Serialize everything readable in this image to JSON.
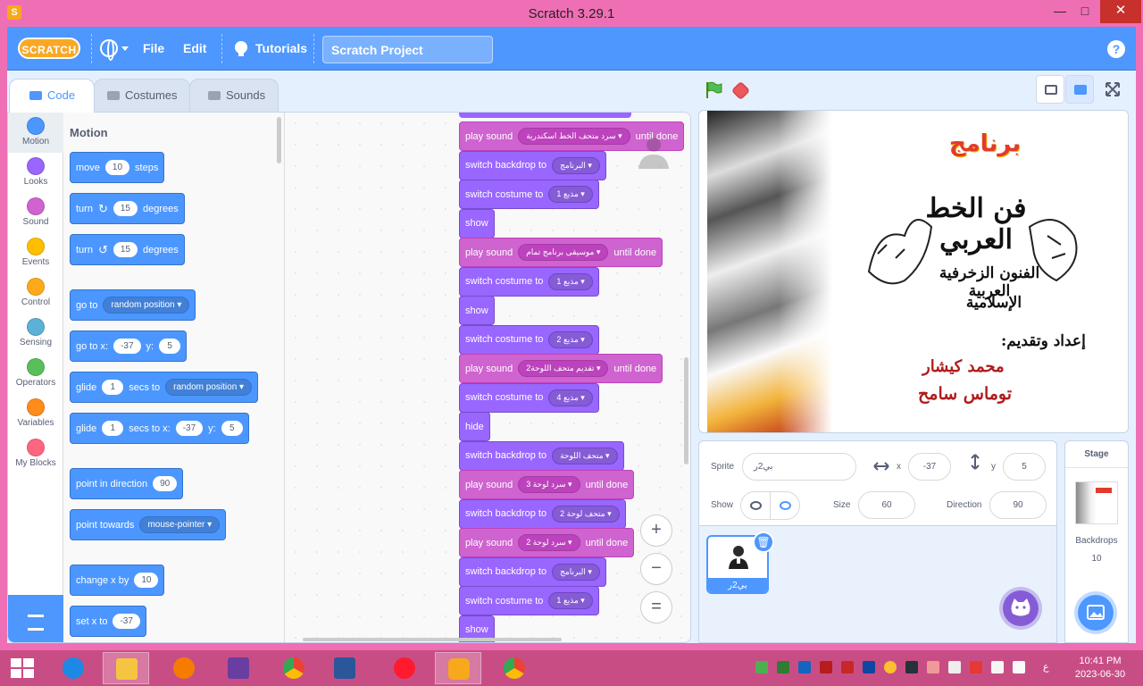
{
  "window": {
    "title": "Scratch 3.29.1",
    "app_icon": "S",
    "min_glyph": "—",
    "max_glyph": "□",
    "close_glyph": "✕"
  },
  "menubar": {
    "logo": "SCRATCH",
    "file": "File",
    "edit": "Edit",
    "tutorials": "Tutorials",
    "project_title": "Scratch Project",
    "help": "?",
    "colors": {
      "bar": "#4d97ff"
    }
  },
  "tabs": {
    "code": "Code",
    "costumes": "Costumes",
    "sounds": "Sounds"
  },
  "categories": [
    {
      "label": "Motion",
      "color": "#4c97ff"
    },
    {
      "label": "Looks",
      "color": "#9966ff"
    },
    {
      "label": "Sound",
      "color": "#cf63cf"
    },
    {
      "label": "Events",
      "color": "#ffbf00"
    },
    {
      "label": "Control",
      "color": "#ffab19"
    },
    {
      "label": "Sensing",
      "color": "#5cb1d6"
    },
    {
      "label": "Operators",
      "color": "#59c059"
    },
    {
      "label": "Variables",
      "color": "#ff8c1a"
    },
    {
      "label": "My Blocks",
      "color": "#ff6680"
    }
  ],
  "palette": {
    "heading": "Motion",
    "move": {
      "a": "move",
      "val": "10",
      "b": "steps"
    },
    "turn_right": {
      "a": "turn",
      "val": "15",
      "b": "degrees"
    },
    "turn_left": {
      "a": "turn",
      "val": "15",
      "b": "degrees"
    },
    "goto": {
      "a": "go to",
      "dd": "random position"
    },
    "goto_xy": {
      "a": "go to x:",
      "x": "-37",
      "b": "y:",
      "y": "5"
    },
    "glide_to": {
      "a": "glide",
      "val": "1",
      "b": "secs to",
      "dd": "random position"
    },
    "glide_xy": {
      "a": "glide",
      "val": "1",
      "b": "secs to x:",
      "x": "-37",
      "c": "y:",
      "y": "5"
    },
    "point_dir": {
      "a": "point in direction",
      "val": "90"
    },
    "point_towards": {
      "a": "point towards",
      "dd": "mouse-pointer"
    },
    "change_x": {
      "a": "change x by",
      "val": "10"
    },
    "set_x": {
      "a": "set x to",
      "val": "-37"
    }
  },
  "script": [
    {
      "kind": "sound",
      "label": "play sound",
      "dd": "سرد متحف الخط اسكندرية",
      "suffix": "until done"
    },
    {
      "kind": "looks",
      "label": "switch backdrop to",
      "dd": "البرنامج"
    },
    {
      "kind": "looks",
      "label": "switch costume to",
      "dd": "مذيع 1"
    },
    {
      "kind": "looks",
      "label": "show"
    },
    {
      "kind": "sound",
      "label": "play sound",
      "dd": "موسيقى برنامج تمام",
      "suffix": "until done"
    },
    {
      "kind": "looks",
      "label": "switch costume to",
      "dd": "مذيع 1"
    },
    {
      "kind": "looks",
      "label": "show"
    },
    {
      "kind": "looks",
      "label": "switch costume to",
      "dd": "مذيع 2"
    },
    {
      "kind": "sound",
      "label": "play sound",
      "dd": "تقديم متحف اللوحة2",
      "suffix": "until done"
    },
    {
      "kind": "looks",
      "label": "switch costume to",
      "dd": "مذيع 4"
    },
    {
      "kind": "looks",
      "label": "hide"
    },
    {
      "kind": "looks",
      "label": "switch backdrop to",
      "dd": "متحف اللوحة"
    },
    {
      "kind": "sound",
      "label": "play sound",
      "dd": "سرد لوحة 3",
      "suffix": "until done"
    },
    {
      "kind": "looks",
      "label": "switch backdrop to",
      "dd": "متحف لوحة 2"
    },
    {
      "kind": "sound",
      "label": "play sound",
      "dd": "سرد لوحة 2",
      "suffix": "until done"
    },
    {
      "kind": "looks",
      "label": "switch backdrop to",
      "dd": "البرنامج"
    },
    {
      "kind": "looks",
      "label": "switch costume to",
      "dd": "مذيع 1"
    },
    {
      "kind": "looks",
      "label": "show"
    }
  ],
  "zoom": {
    "in": "+",
    "out": "−",
    "reset": "="
  },
  "stage": {
    "title": "برنامج",
    "calligraphy": "فن الخط العربي",
    "subtitle1": "الفنون الزخرفية العربية",
    "subtitle2": "الإسلامية",
    "credit_label": "إعداد وتقديم:",
    "name1": "محمد كيشار",
    "name2": "توماس سامح"
  },
  "sprite_info": {
    "sprite_label": "Sprite",
    "sprite_name": "بي2ر",
    "x_label": "x",
    "x": "-37",
    "y_label": "y",
    "y": "5",
    "show_label": "Show",
    "size_label": "Size",
    "size": "60",
    "direction_label": "Direction",
    "direction": "90"
  },
  "sprite_tile": {
    "name": "بي2ر"
  },
  "stage_panel": {
    "heading": "Stage",
    "backdrops_label": "Backdrops",
    "backdrops_count": "10"
  },
  "taskbar": {
    "time": "10:41 PM",
    "date": "2023-06-30",
    "lang": "ع"
  }
}
